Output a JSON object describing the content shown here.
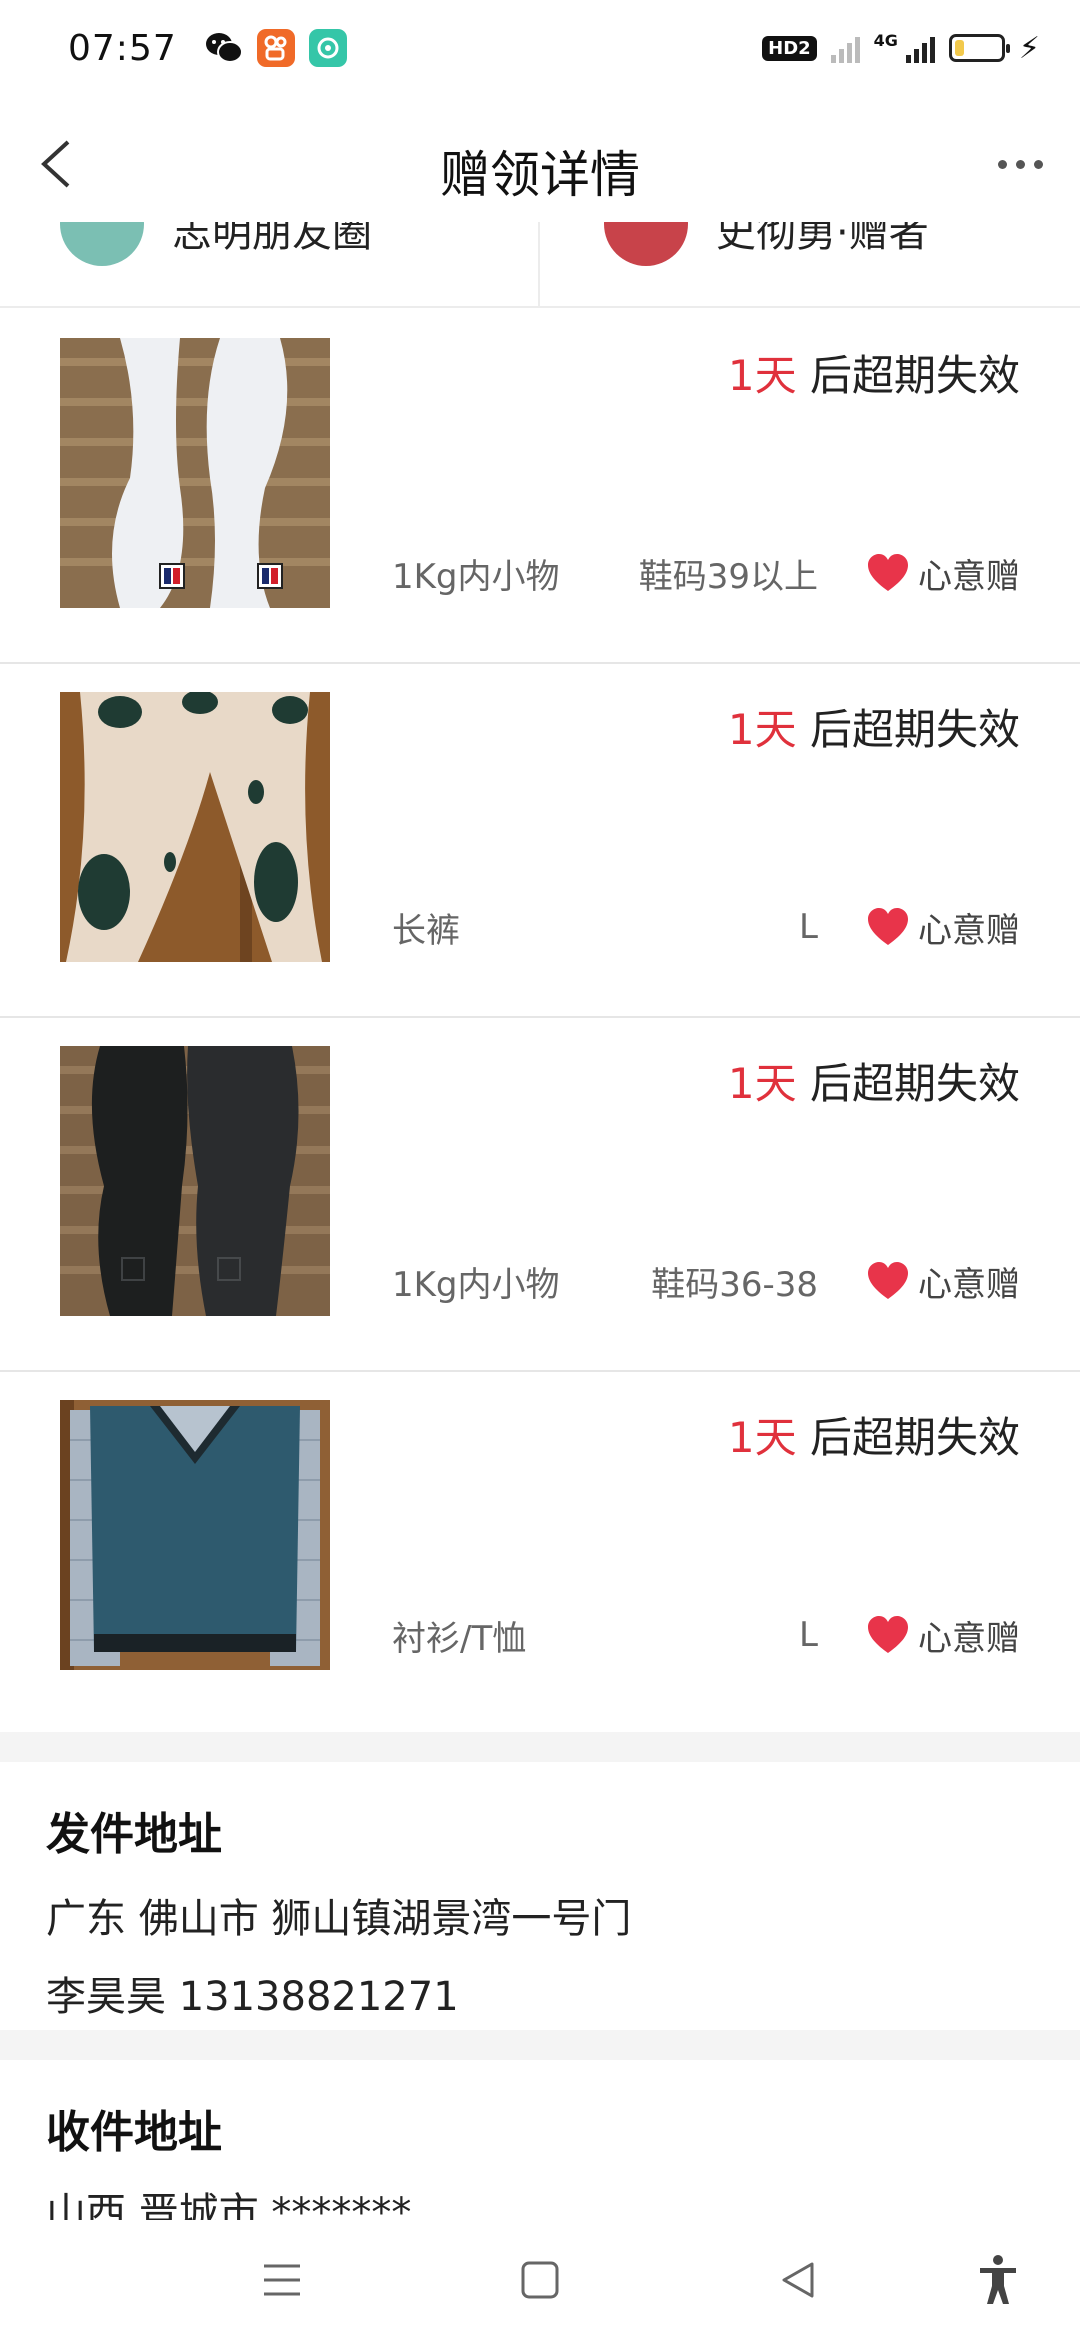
{
  "status_bar": {
    "time": "07:57",
    "hd_label": "HD2",
    "network_label": "4G",
    "battery_level": 0.2
  },
  "header": {
    "title": "赠领详情"
  },
  "users_strip": {
    "left_name": "志明朋友圈",
    "right_name": "史彻勇·赠者"
  },
  "items": [
    {
      "expiry_days": "1天",
      "expiry_suffix": " 后超期失效",
      "category": "1Kg内小物",
      "size": "鞋码39以上",
      "gift_label": "心意赠",
      "image_desc": "insole-white-fila"
    },
    {
      "expiry_days": "1天",
      "expiry_suffix": " 后超期失效",
      "category": "长裤",
      "size": "L",
      "gift_label": "心意赠",
      "image_desc": "pants-beige-print"
    },
    {
      "expiry_days": "1天",
      "expiry_suffix": " 后超期失效",
      "category": "1Kg内小物",
      "size": "鞋码36-38",
      "gift_label": "心意赠",
      "image_desc": "insole-black-fila"
    },
    {
      "expiry_days": "1天",
      "expiry_suffix": " 后超期失效",
      "category": "衬衫/T恤",
      "size": "L",
      "gift_label": "心意赠",
      "image_desc": "sweater-vest-blue"
    }
  ],
  "sender": {
    "title": "发件地址",
    "address": "广东 佛山市 狮山镇湖景湾一号门",
    "contact": "李昊昊 13138821271"
  },
  "receiver": {
    "title": "收件地址",
    "address": "山西 晋城市 *******"
  },
  "colors": {
    "accent_red": "#e0313c",
    "heart": "#e8344a"
  }
}
